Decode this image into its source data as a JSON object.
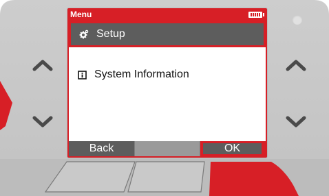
{
  "screen": {
    "title": "Menu",
    "menu_items": [
      {
        "label": "Setup",
        "icon": "gear-icon",
        "selected": true
      },
      {
        "label": "System Information",
        "icon": "info-icon",
        "selected": false
      }
    ],
    "softkeys": {
      "left": "Back",
      "middle": "",
      "right": "OK"
    },
    "battery_icon": "battery-icon"
  },
  "colors": {
    "accent_red": "#d71f26",
    "selection_gray": "#5d5d5d",
    "device_gray": "#c9c9c9"
  },
  "device": {
    "buttons": [
      "up-arrow-left",
      "down-arrow-left",
      "up-arrow-right",
      "down-arrow-right"
    ]
  }
}
